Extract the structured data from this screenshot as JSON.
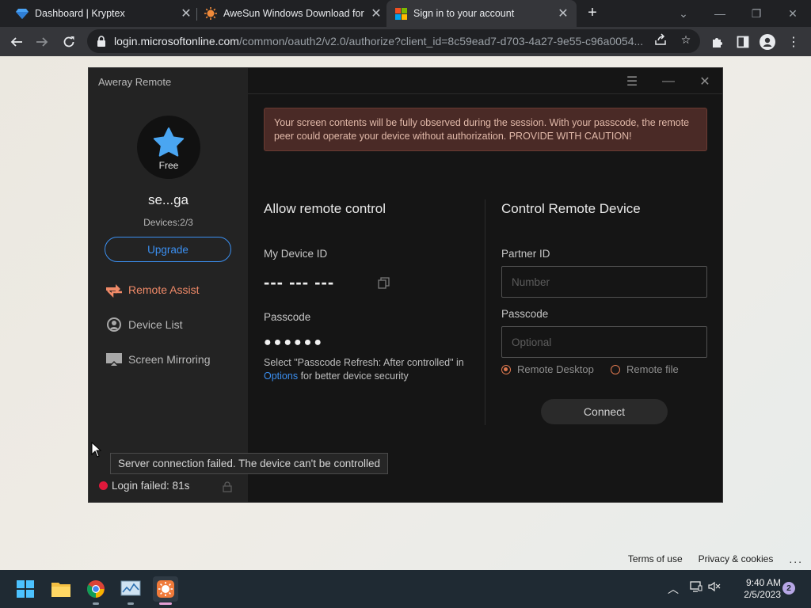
{
  "browser": {
    "tabs": [
      {
        "title": "Dashboard | Kryptex",
        "icon": "kryptex-diamond-icon",
        "active": false
      },
      {
        "title": "AweSun Windows Download for",
        "icon": "awesun-sun-icon",
        "active": false
      },
      {
        "title": "Sign in to your account",
        "icon": "microsoft-logo-icon",
        "active": true
      }
    ],
    "url_host": "login.microsoftonline.com",
    "url_path": "/common/oauth2/v2.0/authorize?client_id=8c59ead7-d703-4a27-9e55-c96a0054..."
  },
  "app": {
    "title": "Aweray Remote",
    "account": {
      "tier": "Free",
      "username": "se...ga",
      "devices": "Devices:2/3",
      "upgrade_label": "Upgrade"
    },
    "nav": [
      {
        "label": "Remote Assist",
        "icon": "remote-assist-icon",
        "active": true
      },
      {
        "label": "Device List",
        "icon": "device-list-icon",
        "active": false
      },
      {
        "label": "Screen Mirroring",
        "icon": "screen-mirroring-icon",
        "active": false
      }
    ],
    "tooltip": "Server connection failed. The device can't be controlled",
    "login_status": "Login failed: 81s",
    "warning": "Your screen contents will be fully observed during the session. With your passcode, the remote peer could operate your device without authorization. PROVIDE WITH CAUTION!",
    "allow": {
      "title": "Allow remote control",
      "device_id_label": "My Device ID",
      "device_id_value": "--- --- ---",
      "passcode_label": "Passcode",
      "passcode_value": "●●●●●●",
      "hint_before": "Select \"Passcode Refresh: After controlled\" in ",
      "hint_link": "Options",
      "hint_after": " for better device security"
    },
    "control": {
      "title": "Control Remote Device",
      "partner_label": "Partner ID",
      "partner_placeholder": "Number",
      "passcode_label": "Passcode",
      "passcode_placeholder": "Optional",
      "mode_options": [
        "Remote Desktop",
        "Remote file"
      ],
      "selected_mode": "Remote Desktop",
      "connect_label": "Connect"
    }
  },
  "page_footer": {
    "terms": "Terms of use",
    "privacy": "Privacy & cookies",
    "more": "..."
  },
  "taskbar": {
    "time": "9:40 AM",
    "date": "2/5/2023",
    "notification_count": "2"
  },
  "colors": {
    "accent_blue": "#3b8ff0",
    "accent_orange": "#f08a68",
    "error_red": "#e0193b",
    "warning_bg": "#4a2a26"
  }
}
